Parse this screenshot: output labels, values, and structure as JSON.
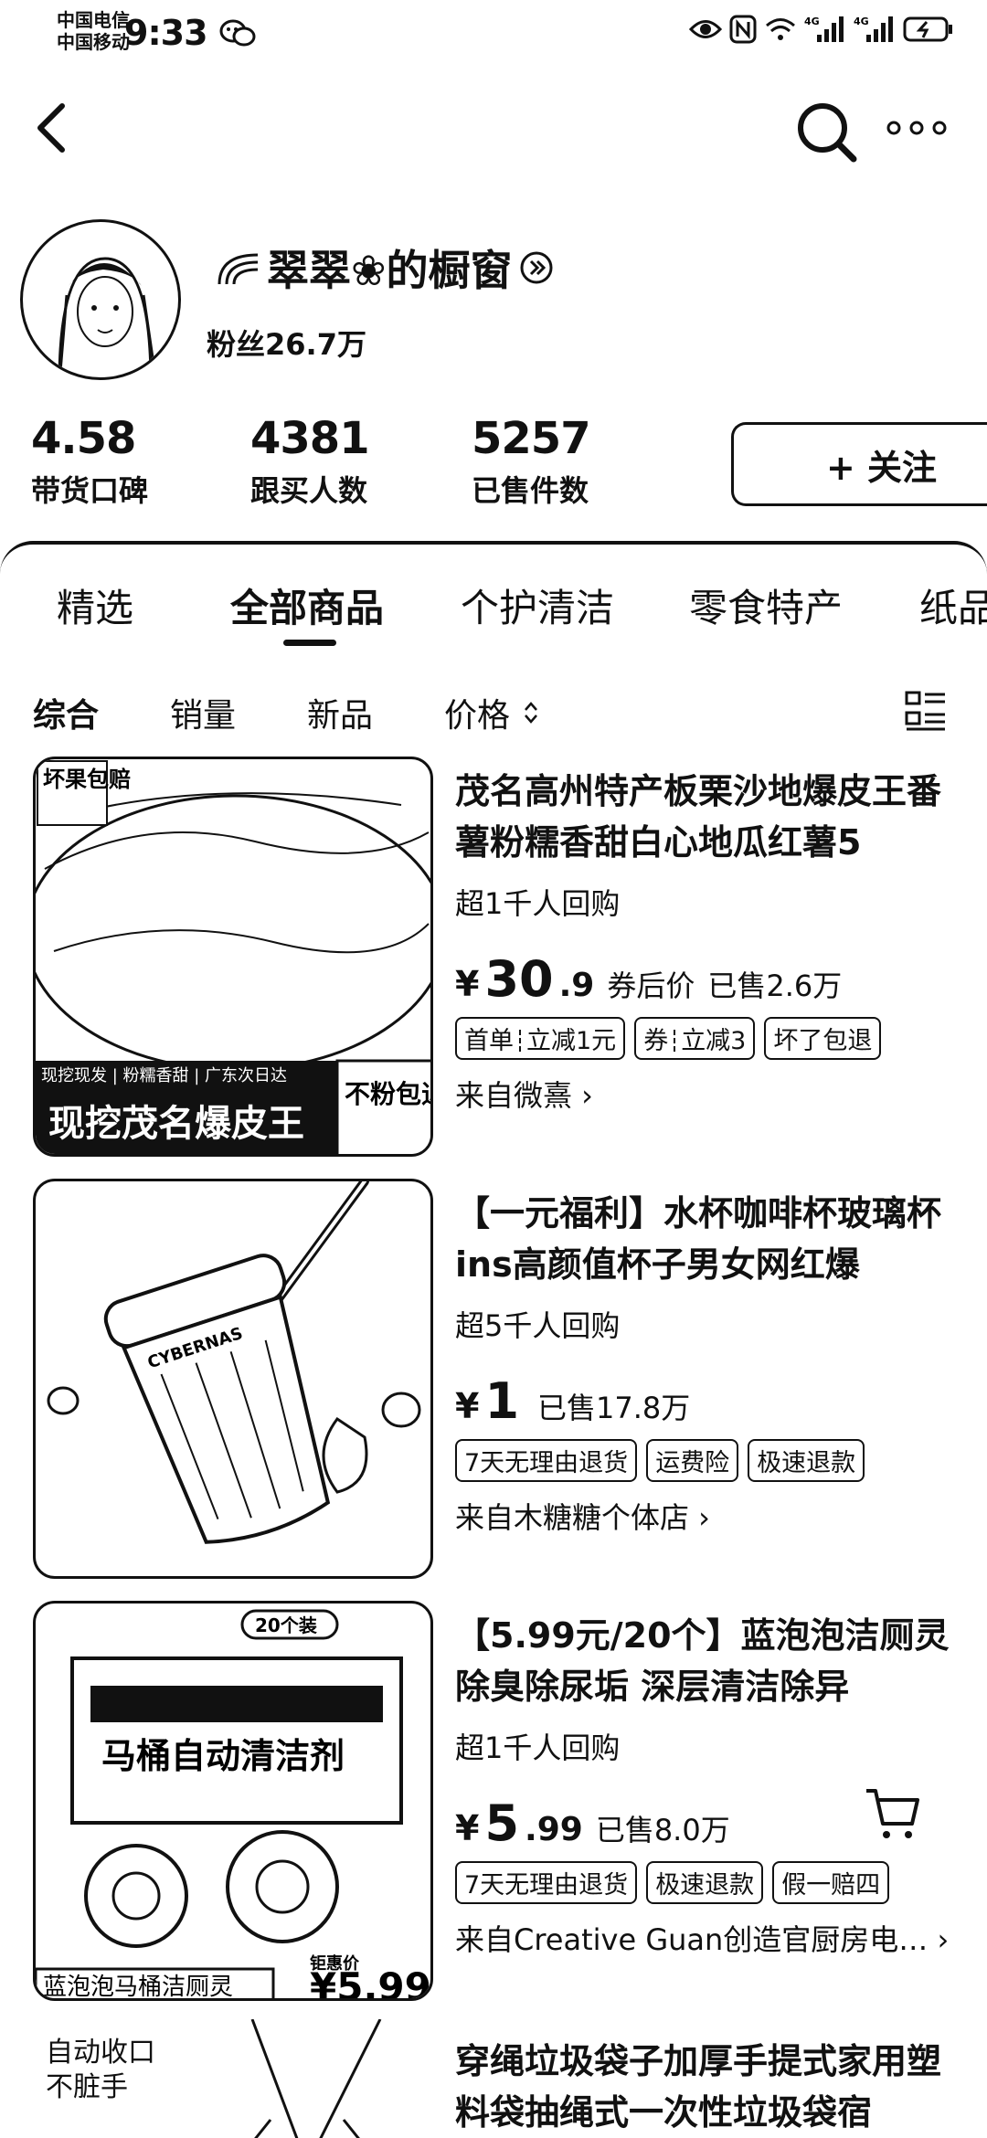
{
  "status_bar": {
    "carrier_1": "中国电信",
    "carrier_2": "中国移动",
    "time": "9:33"
  },
  "shop": {
    "name": "翠翠❀的橱窗",
    "fans": "粉丝26.7万",
    "follow_label": "+ 关注"
  },
  "stats": [
    {
      "value": "4.58",
      "label": "带货口碑"
    },
    {
      "value": "4381",
      "label": "跟买人数"
    },
    {
      "value": "5257",
      "label": "已售件数"
    }
  ],
  "category_tabs": [
    "精选",
    "全部商品",
    "个护清洁",
    "零食特产",
    "纸品"
  ],
  "active_category": "全部商品",
  "sort_options": [
    "综合",
    "销量",
    "新品",
    "价格"
  ],
  "products": [
    {
      "title": "茂名高州特产板栗沙地爆皮王番薯粉糯香甜白心地瓜红薯5",
      "repurchase": "超1千人回购",
      "currency": "¥",
      "price_int": "30",
      "price_dec": ".9",
      "price_note": "券后价",
      "sold": "已售2.6万",
      "tags": [
        [
          "首单",
          "立减1元"
        ],
        [
          "券",
          "立减3"
        ],
        [
          "坏了包退"
        ]
      ],
      "shop": "来自微熹 ›",
      "image_text": {
        "badge": "坏果包赔",
        "strip": "现挖现发 | 粉糯香甜 | 广东次日达",
        "banner": "现挖茂名爆皮王",
        "corner": "不粉包退"
      }
    },
    {
      "title": "【一元福利】水杯咖啡杯玻璃杯ins高颜值杯子男女网红爆",
      "repurchase": "超5千人回购",
      "currency": "¥",
      "price_int": "1",
      "price_dec": "",
      "price_note": "",
      "sold": "已售17.8万",
      "tags": [
        [
          "7天无理由退货"
        ],
        [
          "运费险"
        ],
        [
          "极速退款"
        ]
      ],
      "shop": "来自木糖糖个体店 ›",
      "image_text": {
        "label": "CYBERNAS"
      }
    },
    {
      "title": "【5.99元/20个】蓝泡泡洁厕灵 除臭除尿垢 深层清洁除异",
      "repurchase": "超1千人回购",
      "currency": "¥",
      "price_int": "5",
      "price_dec": ".99",
      "price_note": "",
      "sold": "已售8.0万",
      "tags": [
        [
          "7天无理由退货"
        ],
        [
          "极速退款"
        ],
        [
          "假一赔四"
        ]
      ],
      "shop": "来自Creative Guan创造官厨房电… ›",
      "image_text": {
        "badge": "20个装",
        "pack": "马桶自动清洁剂",
        "caption": "蓝泡泡马桶洁厕灵",
        "price_tag": "钜惠价",
        "price": "¥5.99"
      }
    }
  ],
  "partial_product": {
    "title": "穿绳垃圾袋子加厚手提式家用塑料袋抽绳式一次性垃圾袋宿",
    "image_text": [
      "自动收口",
      "不脏手"
    ]
  }
}
